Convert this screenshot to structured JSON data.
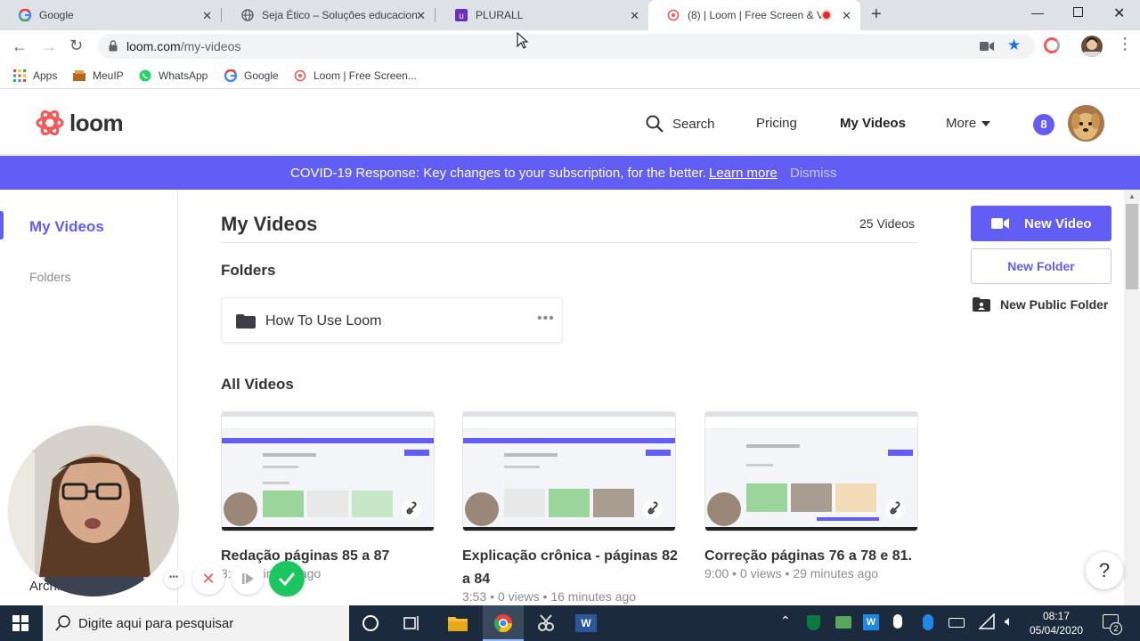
{
  "browser": {
    "tabs": [
      {
        "title": "Google",
        "active": false
      },
      {
        "title": "Seja Ético – Soluções educaciona",
        "active": false
      },
      {
        "title": "PLURALL",
        "active": false
      },
      {
        "title": "(8) | Loom | Free Screen & Vi",
        "active": true
      }
    ],
    "url_host": "loom.com",
    "url_path": "/my-videos",
    "bookmarks": [
      "Apps",
      "MeuIP",
      "WhatsApp",
      "Google",
      "Loom | Free Screen..."
    ]
  },
  "loom": {
    "logo_text": "loom",
    "nav": {
      "search": "Search",
      "pricing": "Pricing",
      "my_videos": "My Videos",
      "more": "More"
    },
    "notification_count": "8",
    "banner": {
      "text": "COVID-19 Response: Key changes to your subscription, for the better.",
      "link": "Learn more",
      "dismiss": "Dismiss"
    },
    "sidebar": {
      "my_videos": "My Videos",
      "folders": "Folders",
      "archive": "Archi"
    },
    "main": {
      "title": "My Videos",
      "video_count": "25 Videos",
      "folders_heading": "Folders",
      "folder_name": "How To Use Loom",
      "all_videos_heading": "All Videos"
    },
    "actions": {
      "new_video": "New Video",
      "new_folder": "New Folder",
      "new_public_folder": "New Public Folder"
    },
    "videos": [
      {
        "title": "Redação páginas 85 a 87",
        "duration": "3:",
        "views": "",
        "age": "6 minutes ago"
      },
      {
        "title": "Explicação crônica - páginas 82 a 84",
        "duration": "3:53",
        "views": "0 views",
        "age": "16 minutes ago"
      },
      {
        "title": "Correção páginas 76 a 78 e 81.",
        "duration": "9:00",
        "views": "0 views",
        "age": "29 minutes ago"
      }
    ],
    "help_label": "?"
  },
  "taskbar": {
    "search_placeholder": "Digite aqui para pesquisar",
    "time": "08:17",
    "date": "05/04/2020",
    "notifications": "2"
  },
  "colors": {
    "brand": "#625df5",
    "loom_red": "#f25a5a",
    "taskbar": "#1b2a3c"
  }
}
